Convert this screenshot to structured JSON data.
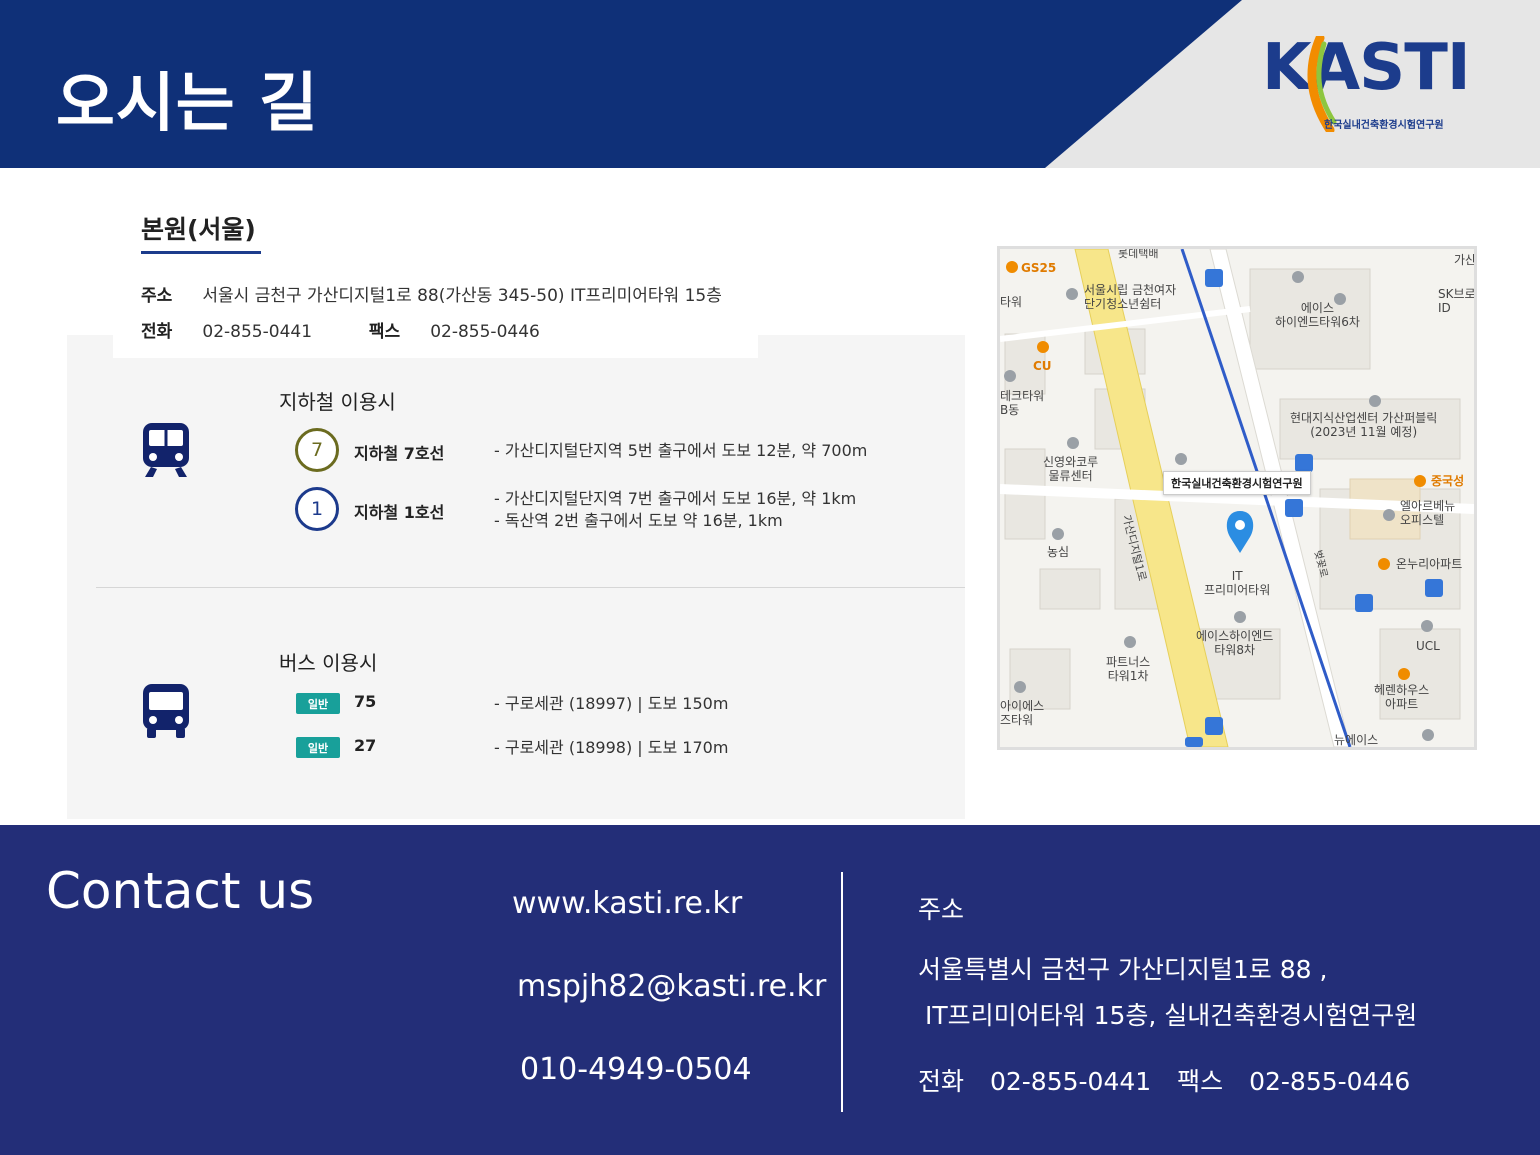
{
  "header": {
    "title": "오시는 길",
    "logo_text": "KASTI",
    "logo_subtitle": "한국실내건축환경시험연구원"
  },
  "branch": {
    "title": "본원(서울)",
    "address_label": "주소",
    "address": "서울시 금천구 가산디지털1로 88(가산동 345-50) IT프리미어타워 15층",
    "tel_label": "전화",
    "tel": "02-855-0441",
    "fax_label": "팩스",
    "fax": "02-855-0446"
  },
  "subway": {
    "title": "지하철 이용시",
    "lines": [
      {
        "badge": "7",
        "name": "지하철 7호선",
        "color": "#6b6b1f",
        "desc": [
          "- 가산디지털단지역 5번 출구에서 도보 12분, 약 700m"
        ]
      },
      {
        "badge": "1",
        "name": "지하철 1호선",
        "color": "#1c3a8c",
        "desc": [
          "- 가산디지털단지역 7번 출구에서 도보 16분, 약 1km",
          "- 독산역 2번 출구에서 도보 약 16분, 1km"
        ]
      }
    ]
  },
  "bus": {
    "title": "버스 이용시",
    "routes": [
      {
        "tag": "일반",
        "number": "75",
        "desc": "- 구로세관 (18997) | 도보 150m"
      },
      {
        "tag": "일반",
        "number": "27",
        "desc": "- 구로세관 (18998) | 도보 170m"
      }
    ]
  },
  "map": {
    "callout": "한국실내건축환경시험연구원",
    "labels": {
      "gs25": "GS25",
      "cu": "CU",
      "youth": "서울시립 금천여자\n단기청소년쉼터",
      "tower_left": "타워",
      "aceshigh6": "에이스\n하이엔드타워6차",
      "sk": "SK브로\nID",
      "gasan_top": "가산",
      "techtower": "테크타워\nB동",
      "hyundai": "현대지식산업센터 가산퍼블릭\n(2023년 11월 예정)",
      "sinyoung": "신영와코루\n물류센터",
      "china": "중국성",
      "elarbe": "엘아르베뉴\n오피스텔",
      "nongshim": "농심",
      "it_tower": "IT\n프리미어타워",
      "onnuri": "온누리아파트",
      "road_main": "가산디지털1로",
      "road_side": "벚꽃로",
      "aceshigh8": "에이스하이엔드\n타워8차",
      "ucl": "UCL",
      "partners": "파트너스\n타워1차",
      "helen": "헤렌하우스\n아파트",
      "aies": "아이에스\n즈타워",
      "newace": "뉴에이스",
      "lotte": "롯데택배"
    }
  },
  "contact": {
    "title": "Contact us",
    "website": "www.kasti.re.kr",
    "email": "mspjh82@kasti.re.kr",
    "phone": "010-4949-0504",
    "address_label": "주소",
    "address_line1": "서울특별시 금천구 가산디지털1로 88 ,",
    "address_line2": "IT프리미어타워  15층, 실내건축환경시험연구원",
    "tel_label": "전화",
    "tel": "02-855-0441",
    "fax_label": "팩스",
    "fax": "02-855-0446"
  }
}
